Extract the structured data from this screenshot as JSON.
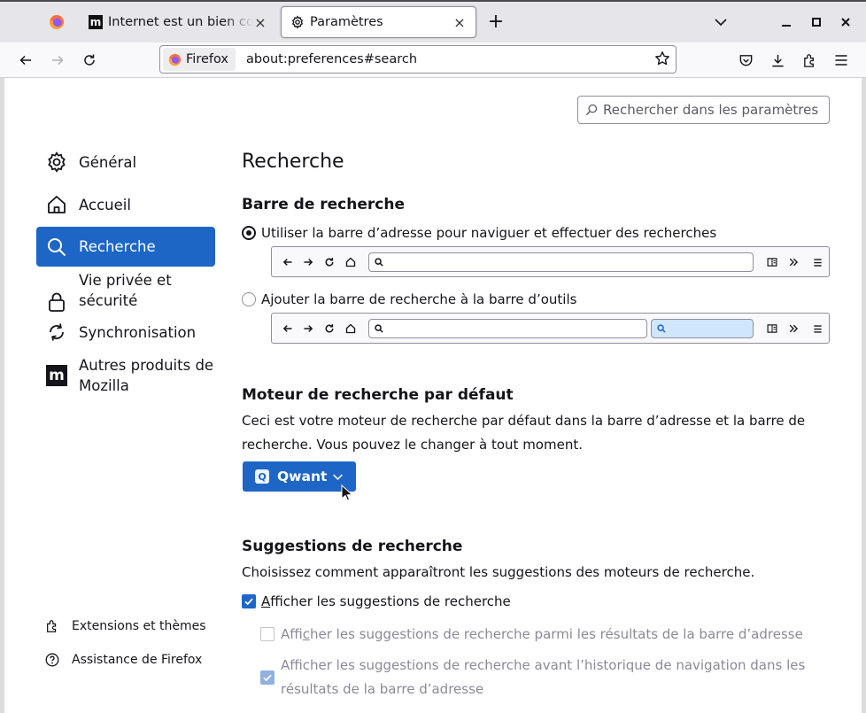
{
  "tabs": {
    "inactive_title": "Internet est un bien commun",
    "active_title": "Paramètres",
    "close_glyph": "×",
    "new_tab_glyph": "+"
  },
  "navbar": {
    "identity_label": "Firefox",
    "url": "about:preferences#search"
  },
  "search_prefs": {
    "placeholder": "Rechercher dans les paramètres"
  },
  "sidebar": {
    "items": [
      {
        "label": "Général",
        "icon": "gear-icon"
      },
      {
        "label": "Accueil",
        "icon": "home-icon"
      },
      {
        "label": "Recherche",
        "icon": "search-icon",
        "selected": true
      },
      {
        "label": "Vie privée et sécurité",
        "icon": "lock-icon"
      },
      {
        "label": "Synchronisation",
        "icon": "sync-icon"
      },
      {
        "label": "Autres produits de Mozilla",
        "icon": "mozilla-icon"
      }
    ],
    "footer": [
      {
        "label": "Extensions et thèmes",
        "icon": "puzzle-icon"
      },
      {
        "label": "Assistance de Firefox",
        "icon": "help-icon"
      }
    ]
  },
  "main": {
    "page_title": "Recherche",
    "search_bar": {
      "heading": "Barre de recherche",
      "option_address": "Utiliser la barre d’adresse pour naviguer et effectuer des recherches",
      "option_toolbar": "Ajouter la barre de recherche à la barre d’outils",
      "selected": "address"
    },
    "default_engine": {
      "heading": "Moteur de recherche par défaut",
      "description": "Ceci est votre moteur de recherche par défaut dans la barre d’adresse et la barre de recherche. Vous pouvez le changer à tout moment.",
      "engine_name": "Qwant",
      "engine_icon_letter": "Q"
    },
    "suggestions": {
      "heading": "Suggestions de recherche",
      "description": "Choisissez comment apparaîtront les suggestions des moteurs de recherche.",
      "show_label_ul": "A",
      "show_label_rest": "fficher les suggestions de recherche",
      "in_address_pre": "Affi",
      "in_address_ul": "c",
      "in_address_post": "her les suggestions de recherche parmi les résultats de la barre d’adresse",
      "before_history": "Afficher les suggestions de recherche avant l’historique de navigation dans les résultats de la barre d’adresse",
      "show_checked": true,
      "in_address_checked": false,
      "before_history_checked": true
    }
  },
  "colors": {
    "accent": "#1d66c6",
    "search_bar_highlight": "#cfe6fd"
  }
}
